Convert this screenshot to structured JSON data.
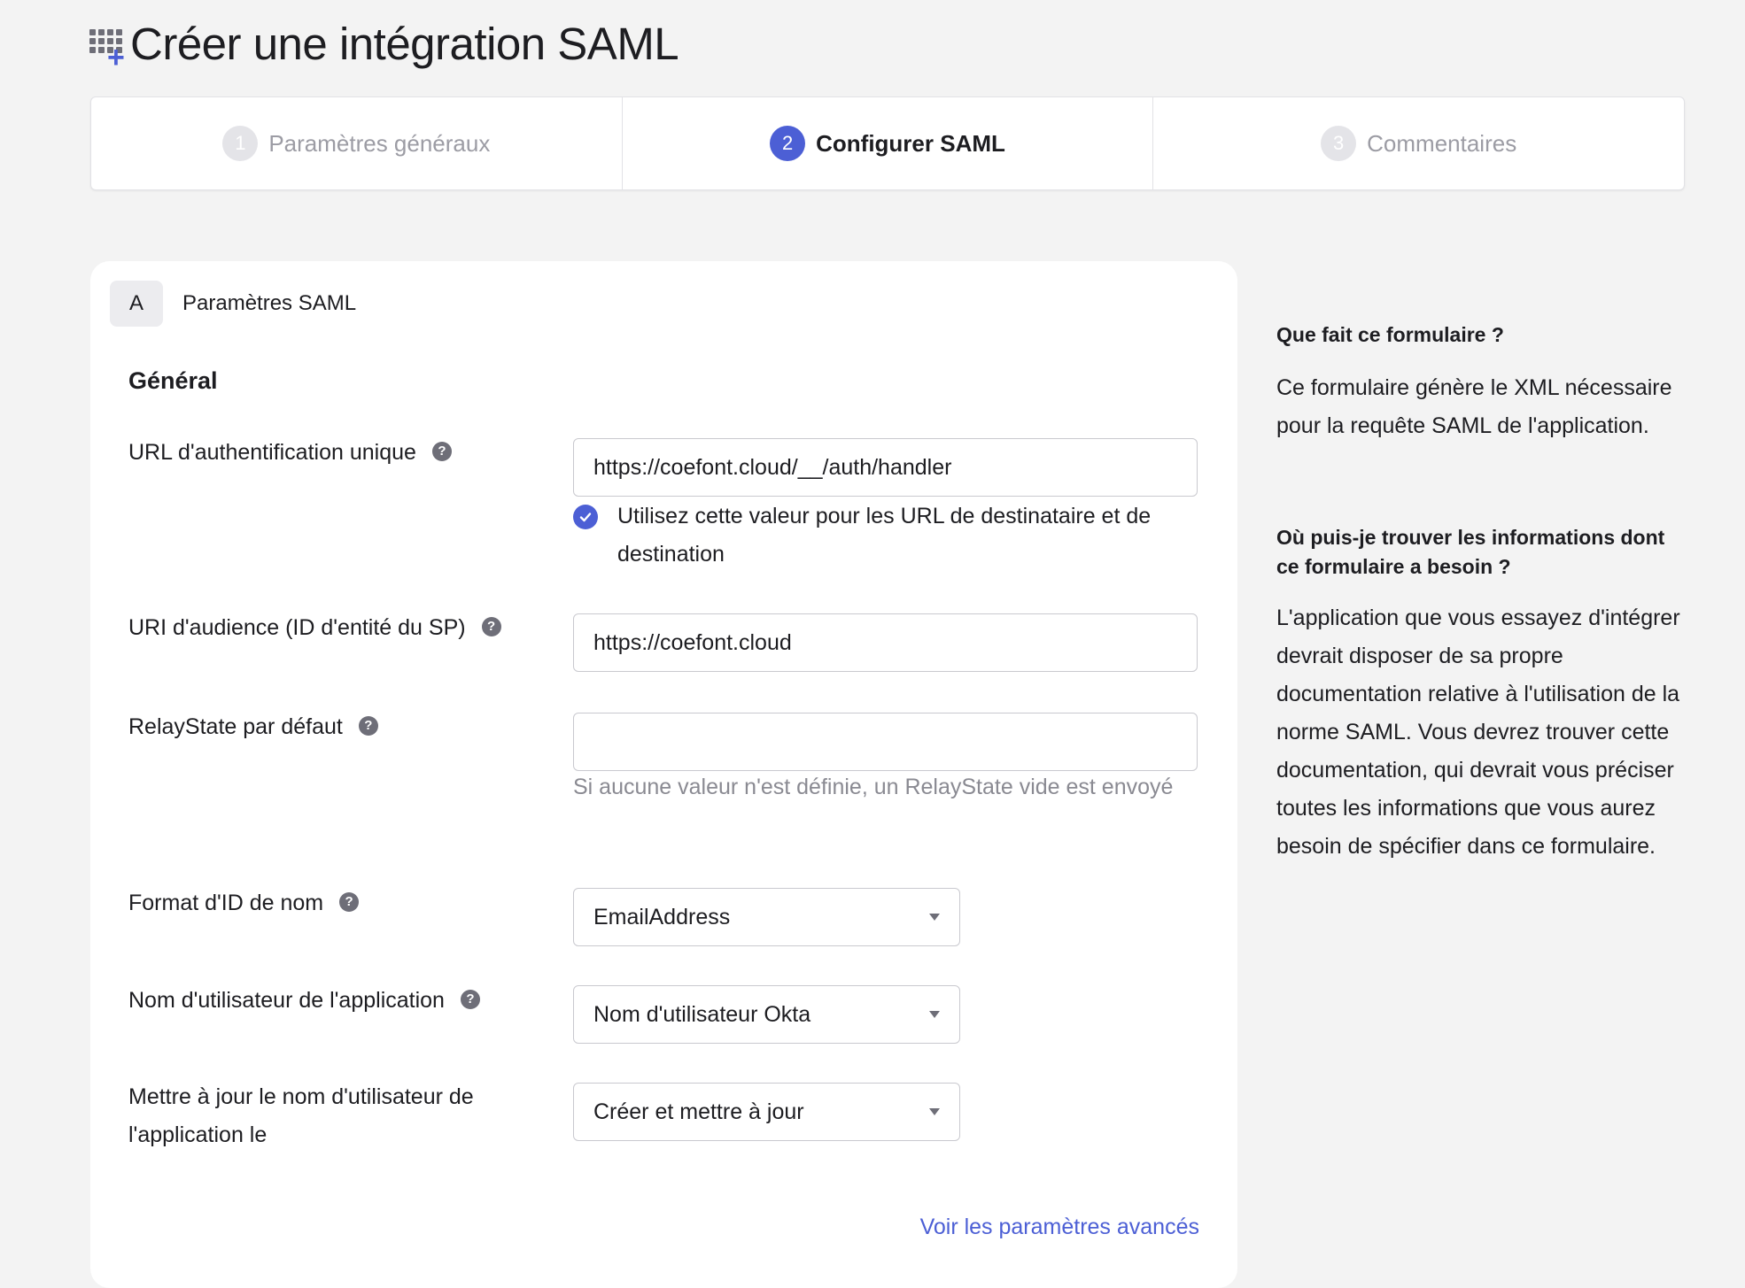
{
  "page": {
    "title": "Créer une intégration SAML"
  },
  "stepper": {
    "steps": [
      {
        "num": "1",
        "label": "Paramètres généraux"
      },
      {
        "num": "2",
        "label": "Configurer SAML"
      },
      {
        "num": "3",
        "label": "Commentaires"
      }
    ]
  },
  "card": {
    "section_letter": "A",
    "section_title": "Paramètres SAML",
    "subheading": "Général",
    "fields": {
      "sso_url": {
        "label": "URL d'authentification unique",
        "value": "https://coefont.cloud/__/auth/handler"
      },
      "use_for_recipient": {
        "label": "Utilisez cette valeur pour les URL de destinataire et de destination",
        "checked": true
      },
      "audience_uri": {
        "label": "URI d'audience (ID d'entité du SP)",
        "value": "https://coefont.cloud"
      },
      "relay_state": {
        "label": "RelayState par défaut",
        "value": "",
        "hint": "Si aucune valeur n'est définie, un RelayState vide est envoyé"
      },
      "name_id_format": {
        "label": "Format d'ID de nom",
        "value": "EmailAddress"
      },
      "app_username": {
        "label": "Nom d'utilisateur de l'application",
        "value": "Nom d'utilisateur Okta"
      },
      "update_username_on": {
        "label": "Mettre à jour le nom d'utilisateur de l'application le",
        "value": "Créer et mettre à jour"
      }
    },
    "advanced_link": "Voir les paramètres avancés"
  },
  "sidebar": {
    "q1": "Que fait ce formulaire ?",
    "a1": "Ce formulaire génère le XML nécessaire pour la requête SAML de l'application.",
    "q2": "Où puis-je trouver les informations dont ce formulaire a besoin ?",
    "a2": "L'application que vous essayez d'intégrer devrait disposer de sa propre documentation relative à l'utilisation de la norme SAML. Vous devrez trouver cette documentation, qui devrait vous préciser toutes les informations que vous aurez besoin de spécifier dans ce formulaire."
  },
  "colors": {
    "accent": "#4c5fd5",
    "background": "#f3f3f3"
  },
  "icons": {
    "title": "app-grid-add-icon",
    "help": "help-icon",
    "select": "caret-down-icon",
    "check": "checkmark-icon"
  }
}
